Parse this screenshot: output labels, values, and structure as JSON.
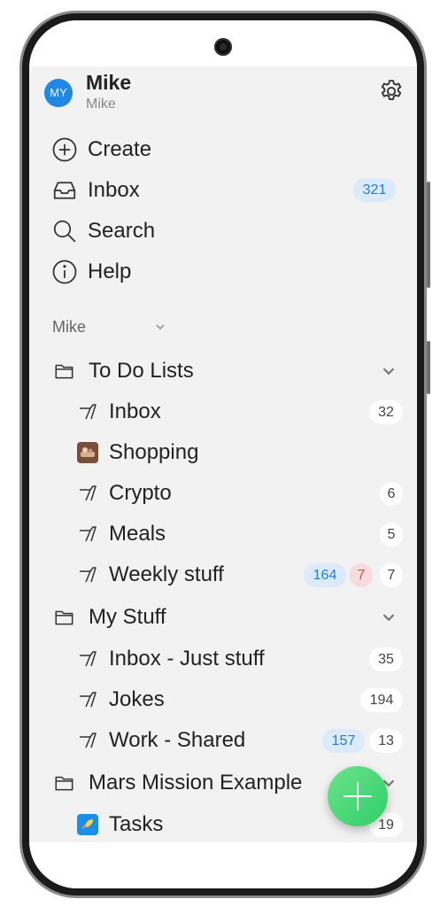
{
  "profile": {
    "avatar_initials": "MY",
    "name": "Mike",
    "subtitle": "Mike"
  },
  "nav": [
    {
      "label": "Create",
      "icon": "plus-circle-icon"
    },
    {
      "label": "Inbox",
      "icon": "tray-icon",
      "badge": "321"
    },
    {
      "label": "Search",
      "icon": "search-icon"
    },
    {
      "label": "Help",
      "icon": "info-icon"
    }
  ],
  "workspace": {
    "label": "Mike"
  },
  "groups": [
    {
      "label": "To Do Lists",
      "items": [
        {
          "label": "Inbox",
          "count": "32"
        },
        {
          "label": "Shopping"
        },
        {
          "label": "Crypto",
          "count": "6"
        },
        {
          "label": "Meals",
          "count": "5"
        },
        {
          "label": "Weekly stuff",
          "badge_blue": "164",
          "badge_red": "7",
          "count": "7"
        }
      ]
    },
    {
      "label": "My Stuff",
      "items": [
        {
          "label": "Inbox - Just stuff",
          "count": "35"
        },
        {
          "label": "Jokes",
          "count": "194"
        },
        {
          "label": "Work - Shared",
          "badge_blue": "157",
          "count": "13"
        }
      ]
    },
    {
      "label": "Mars Mission Example",
      "items": [
        {
          "label": "Tasks",
          "count": "19"
        }
      ]
    }
  ],
  "colors": {
    "accent": "#1f88e5",
    "fab": "#3ad874",
    "badge_blue_bg": "#dcebfb",
    "badge_red_bg": "#f6dcdc"
  }
}
